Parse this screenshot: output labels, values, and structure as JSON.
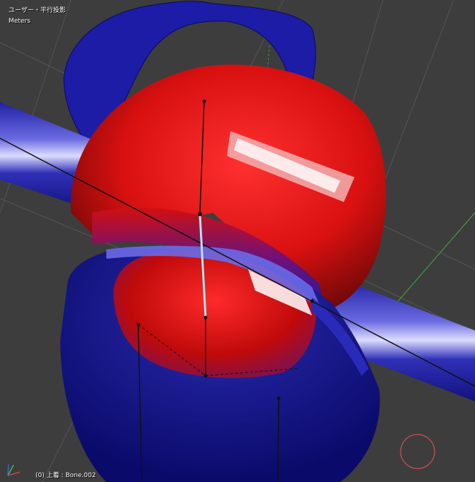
{
  "viewport": {
    "view_mode": "ユーザー・平行投影",
    "units": "Meters",
    "status": "(0) 上着 : Bone.002"
  },
  "colors": {
    "background": "#3d3d3d",
    "weight_high": "#d01010",
    "weight_low": "#1a1a9a",
    "bone_selected": "#a8e8f0",
    "grid_line": "#5a5a5a",
    "rotate_widget": "#d05050"
  },
  "icons": {
    "axis_gizmo": "axis-gizmo-icon",
    "rotate_widget": "rotate-widget-icon"
  }
}
